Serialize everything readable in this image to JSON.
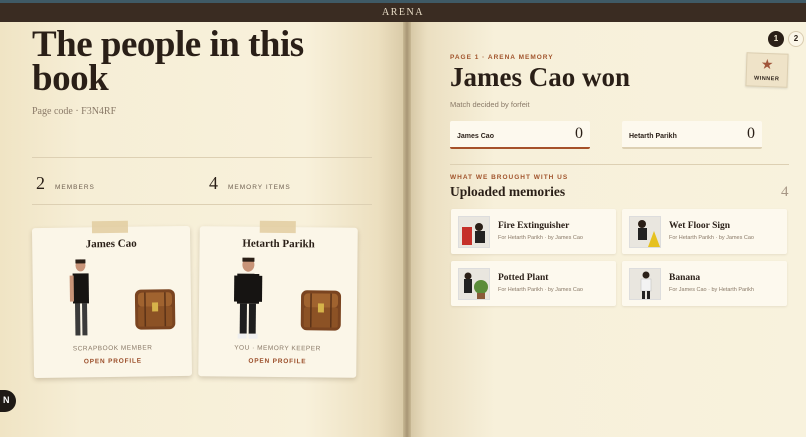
{
  "app": {
    "title": "ARENA"
  },
  "left": {
    "title": "The people in this book",
    "page_code": "Page code · F3N4RF",
    "stats": [
      {
        "value": "2",
        "label": "MEMBERS"
      },
      {
        "value": "4",
        "label": "MEMORY ITEMS"
      }
    ],
    "cards": [
      {
        "name": "James Cao",
        "role": "SCRAPBOOK MEMBER",
        "link": "OPEN PROFILE"
      },
      {
        "name": "Hetarth Parikh",
        "role": "YOU · MEMORY KEEPER",
        "link": "OPEN PROFILE"
      }
    ],
    "nav_button": "N"
  },
  "right": {
    "pagination": [
      "1",
      "2"
    ],
    "kicker": "PAGE 1 · ARENA MEMORY",
    "title": "James Cao won",
    "subtitle": "Match decided by forfeit",
    "badge": "WINNER",
    "scores": [
      {
        "name": "James Cao",
        "score": "0"
      },
      {
        "name": "Hetarth Parikh",
        "score": "0"
      }
    ],
    "memories_kicker": "WHAT WE BROUGHT WITH US",
    "memories_title": "Uploaded memories",
    "memories_count": "4",
    "memories": [
      {
        "title": "Fire Extinguisher",
        "by": "For Hetarth Parikh · by James Cao"
      },
      {
        "title": "Wet Floor Sign",
        "by": "For Hetarth Parikh · by James Cao"
      },
      {
        "title": "Potted Plant",
        "by": "For Hetarth Parikh · by James Cao"
      },
      {
        "title": "Banana",
        "by": "For James Cao · by Hetarth Parikh"
      }
    ]
  },
  "colors": {
    "accent": "#a1542c",
    "dark": "#2a1f17",
    "paper": "#f8f1db"
  }
}
